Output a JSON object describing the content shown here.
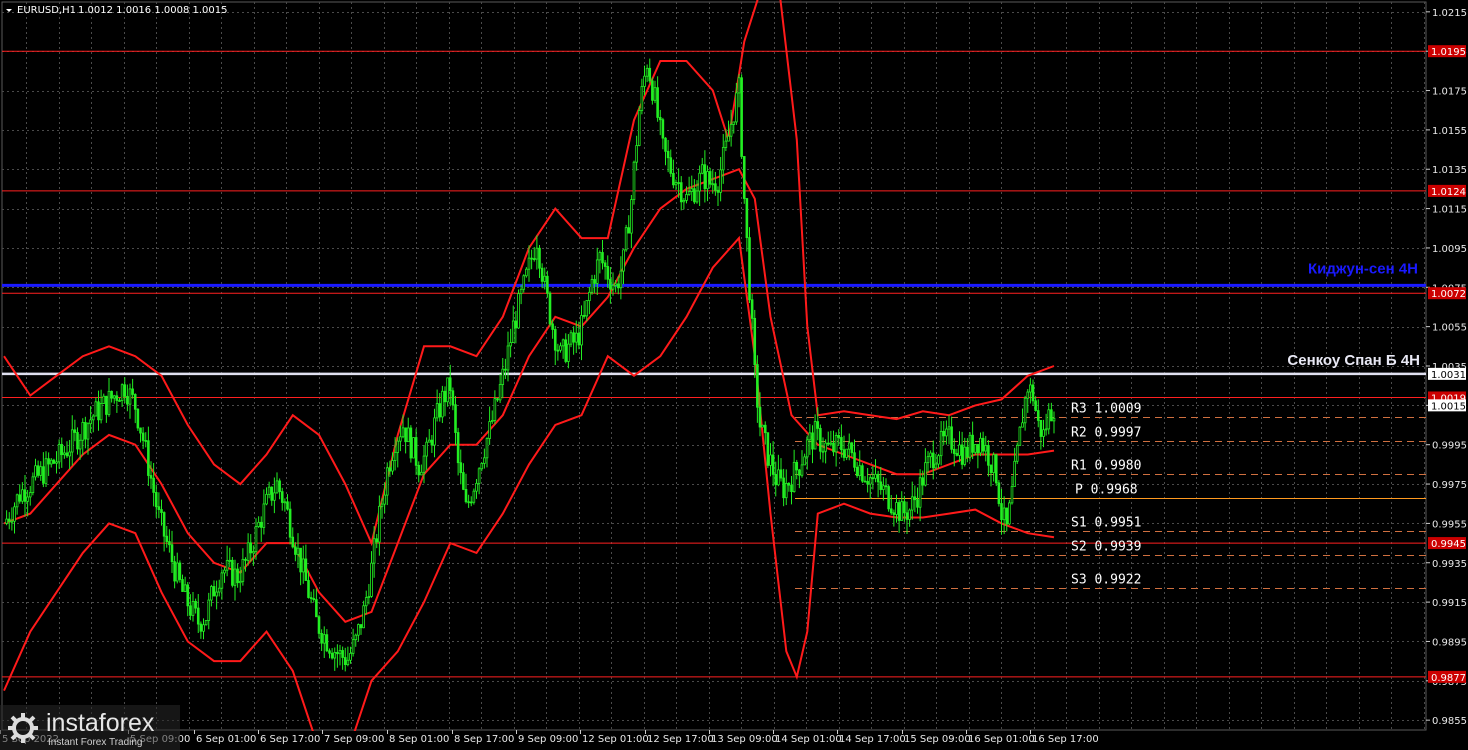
{
  "header": {
    "symbol_label": "EURUSD,H1",
    "ohlc": "1.0012 1.0016 1.0008 1.0015"
  },
  "chart_data": {
    "type": "candlestick",
    "symbol": "EURUSD",
    "timeframe": "H1",
    "ylim": [
      0.985,
      1.022
    ],
    "price_ticks": [
      "1.0215",
      "1.0195",
      "1.0175",
      "1.0155",
      "1.0135",
      "1.0115",
      "1.0095",
      "1.0075",
      "1.0055",
      "1.0035",
      "1.0015",
      "0.9995",
      "0.9975",
      "0.9955",
      "0.9935",
      "0.9915",
      "0.9895",
      "0.9875",
      "0.9855"
    ],
    "time_ticks": [
      "5 Sep 2022",
      "5 Sep 09:00",
      "6 Sep 01:00",
      "6 Sep 17:00",
      "7 Sep 09:00",
      "8 Sep 01:00",
      "8 Sep 17:00",
      "9 Sep 09:00",
      "12 Sep 01:00",
      "12 Sep 17:00",
      "13 Sep 09:00",
      "14 Sep 01:00",
      "14 Sep 17:00",
      "15 Sep 09:00",
      "16 Sep 01:00",
      "16 Sep 17:00"
    ],
    "price_markers": [
      {
        "value": "1.0195",
        "color": "#cc0000"
      },
      {
        "value": "1.0124",
        "color": "#cc0000"
      },
      {
        "value": "1.0072",
        "color": "#cc0000"
      },
      {
        "value": "1.0031",
        "color": "#ffffff"
      },
      {
        "value": "1.0019",
        "color": "#cc0000"
      },
      {
        "value": "1.0015",
        "color": "#ffffff"
      },
      {
        "value": "0.9945",
        "color": "#cc0000"
      },
      {
        "value": "0.9877",
        "color": "#cc0000"
      }
    ],
    "horizontal_levels": [
      {
        "name": "level-10195",
        "value": 1.0195,
        "color": "#ff2020",
        "style": "solid"
      },
      {
        "name": "level-10124",
        "value": 1.0124,
        "color": "#ff2020",
        "style": "solid"
      },
      {
        "name": "kijun-sen-4h",
        "value": 1.0076,
        "color": "#1a1aff",
        "style": "solid"
      },
      {
        "name": "level-10072",
        "value": 1.0072,
        "color": "#ff2020",
        "style": "solid"
      },
      {
        "name": "senkou-span-b-4h",
        "value": 1.0031,
        "color": "#e0e0f0",
        "style": "solid"
      },
      {
        "name": "level-10019",
        "value": 1.0019,
        "color": "#ff2020",
        "style": "solid"
      },
      {
        "name": "level-09945",
        "value": 0.9945,
        "color": "#ff2020",
        "style": "solid"
      },
      {
        "name": "level-09877",
        "value": 0.9877,
        "color": "#ff2020",
        "style": "solid"
      }
    ],
    "pivots": [
      {
        "label": "R3",
        "value": 1.0009
      },
      {
        "label": "R2",
        "value": 0.9997
      },
      {
        "label": "R1",
        "value": 0.998
      },
      {
        "label": "P",
        "value": 0.9968
      },
      {
        "label": "S1",
        "value": 0.9951
      },
      {
        "label": "S2",
        "value": 0.9939
      },
      {
        "label": "S3",
        "value": 0.9922
      }
    ],
    "annotations": {
      "kijun": "Киджун-сен 4Н",
      "senkou": "Сенкоу Спан Б 4Н"
    },
    "close_path": [
      [
        0,
        0.9955
      ],
      [
        3,
        0.9962
      ],
      [
        6,
        0.997
      ],
      [
        10,
        0.9975
      ],
      [
        14,
        0.998
      ],
      [
        18,
        0.9985
      ],
      [
        22,
        0.999
      ],
      [
        26,
        0.9996
      ],
      [
        30,
        1.0003
      ],
      [
        34,
        1.001
      ],
      [
        38,
        1.0015
      ],
      [
        42,
        1.002
      ],
      [
        46,
        1.0025
      ],
      [
        50,
        1.0015
      ],
      [
        53,
        0.9998
      ],
      [
        56,
        0.9978
      ],
      [
        59,
        0.9958
      ],
      [
        62,
        0.9945
      ],
      [
        65,
        0.9932
      ],
      [
        68,
        0.992
      ],
      [
        71,
        0.9912
      ],
      [
        74,
        0.9905
      ],
      [
        77,
        0.9908
      ],
      [
        80,
        0.9922
      ],
      [
        83,
        0.9932
      ],
      [
        86,
        0.993
      ],
      [
        89,
        0.9928
      ],
      [
        92,
        0.9935
      ],
      [
        95,
        0.9946
      ],
      [
        98,
        0.9958
      ],
      [
        101,
        0.9968
      ],
      [
        104,
        0.9975
      ],
      [
        107,
        0.9965
      ],
      [
        110,
        0.995
      ],
      [
        113,
        0.9935
      ],
      [
        116,
        0.992
      ],
      [
        119,
        0.9905
      ],
      [
        122,
        0.9898
      ],
      [
        125,
        0.9892
      ],
      [
        128,
        0.9888
      ],
      [
        131,
        0.9886
      ],
      [
        134,
        0.9895
      ],
      [
        137,
        0.991
      ],
      [
        140,
        0.9932
      ],
      [
        143,
        0.9958
      ],
      [
        146,
        0.9982
      ],
      [
        149,
        0.9998
      ],
      [
        152,
        1.0005
      ],
      [
        155,
        0.9995
      ],
      [
        158,
        0.9985
      ],
      [
        161,
        0.999
      ],
      [
        164,
        1.0005
      ],
      [
        167,
        1.0018
      ],
      [
        170,
        1.0025
      ],
      [
        173,
        0.9985
      ],
      [
        176,
        0.9962
      ],
      [
        179,
        0.9975
      ],
      [
        182,
        0.999
      ],
      [
        185,
        1.0002
      ],
      [
        188,
        1.0018
      ],
      [
        191,
        1.0035
      ],
      [
        194,
        1.0055
      ],
      [
        197,
        1.007
      ],
      [
        200,
        1.0085
      ],
      [
        203,
        1.01
      ],
      [
        206,
        1.0075
      ],
      [
        209,
        1.0055
      ],
      [
        212,
        1.004
      ],
      [
        215,
        1.0045
      ],
      [
        218,
        1.0048
      ],
      [
        221,
        1.0058
      ],
      [
        224,
        1.0078
      ],
      [
        227,
        1.009
      ],
      [
        230,
        1.0082
      ],
      [
        233,
        1.0075
      ],
      [
        236,
        1.0088
      ],
      [
        239,
        1.012
      ],
      [
        242,
        1.0165
      ],
      [
        245,
        1.019
      ],
      [
        248,
        1.017
      ],
      [
        251,
        1.0145
      ],
      [
        254,
        1.0135
      ],
      [
        257,
        1.0128
      ],
      [
        260,
        1.012
      ],
      [
        263,
        1.0125
      ],
      [
        266,
        1.0132
      ],
      [
        269,
        1.0128
      ],
      [
        272,
        1.013
      ],
      [
        275,
        1.0145
      ],
      [
        278,
        1.0165
      ],
      [
        280,
        1.0175
      ],
      [
        282,
        1.012
      ],
      [
        284,
        1.0075
      ],
      [
        286,
        1.003
      ],
      [
        288,
        1.0005
      ],
      [
        291,
        0.999
      ],
      [
        294,
        0.9978
      ],
      [
        297,
        0.9973
      ],
      [
        300,
        0.9978
      ],
      [
        303,
        0.9985
      ],
      [
        306,
        0.9995
      ],
      [
        309,
        1.0
      ],
      [
        312,
        0.9995
      ],
      [
        315,
        0.9992
      ],
      [
        318,
        0.9995
      ],
      [
        321,
        0.9993
      ],
      [
        324,
        0.9988
      ],
      [
        327,
        0.9982
      ],
      [
        330,
        0.9978
      ],
      [
        333,
        0.9974
      ],
      [
        336,
        0.997
      ],
      [
        339,
        0.9965
      ],
      [
        342,
        0.996
      ],
      [
        345,
        0.9962
      ],
      [
        348,
        0.997
      ],
      [
        351,
        0.9982
      ],
      [
        354,
        0.999
      ],
      [
        357,
        0.9995
      ],
      [
        360,
        0.9998
      ],
      [
        363,
        0.9995
      ],
      [
        366,
        0.999
      ],
      [
        369,
        0.9996
      ],
      [
        372,
        0.9998
      ],
      [
        375,
        0.999
      ],
      [
        378,
        0.998
      ],
      [
        380,
        0.996
      ],
      [
        382,
        0.9952
      ],
      [
        384,
        0.997
      ],
      [
        386,
        0.999
      ],
      [
        388,
        1.001
      ],
      [
        390,
        1.0025
      ],
      [
        392,
        1.002
      ],
      [
        394,
        1.0005
      ],
      [
        396,
        1.0
      ],
      [
        398,
        1.001
      ],
      [
        400,
        1.0015
      ]
    ],
    "bollinger": {
      "middle": [
        [
          0,
          0.9955
        ],
        [
          10,
          0.996
        ],
        [
          20,
          0.9975
        ],
        [
          30,
          0.999
        ],
        [
          40,
          1.0
        ],
        [
          50,
          0.9995
        ],
        [
          60,
          0.9975
        ],
        [
          70,
          0.995
        ],
        [
          80,
          0.9935
        ],
        [
          90,
          0.993
        ],
        [
          100,
          0.9945
        ],
        [
          110,
          0.9945
        ],
        [
          120,
          0.992
        ],
        [
          130,
          0.9905
        ],
        [
          140,
          0.991
        ],
        [
          150,
          0.9945
        ],
        [
          160,
          0.998
        ],
        [
          170,
          0.9995
        ],
        [
          180,
          0.9995
        ],
        [
          190,
          1.001
        ],
        [
          200,
          1.004
        ],
        [
          210,
          1.006
        ],
        [
          220,
          1.0055
        ],
        [
          230,
          1.007
        ],
        [
          240,
          1.0095
        ],
        [
          250,
          1.0115
        ],
        [
          260,
          1.0125
        ],
        [
          270,
          1.013
        ],
        [
          280,
          1.0135
        ],
        [
          286,
          1.012
        ],
        [
          292,
          1.006
        ],
        [
          300,
          1.001
        ],
        [
          310,
          0.9995
        ],
        [
          320,
          0.999
        ],
        [
          330,
          0.9985
        ],
        [
          340,
          0.998
        ],
        [
          350,
          0.998
        ],
        [
          360,
          0.9985
        ],
        [
          370,
          0.999
        ],
        [
          380,
          0.999
        ],
        [
          390,
          0.999
        ],
        [
          400,
          0.9992
        ]
      ],
      "upper": [
        [
          0,
          1.004
        ],
        [
          10,
          1.002
        ],
        [
          20,
          1.003
        ],
        [
          30,
          1.004
        ],
        [
          40,
          1.0045
        ],
        [
          50,
          1.004
        ],
        [
          60,
          1.003
        ],
        [
          70,
          1.0005
        ],
        [
          80,
          0.9985
        ],
        [
          90,
          0.9975
        ],
        [
          100,
          0.999
        ],
        [
          110,
          1.001
        ],
        [
          120,
          1.0
        ],
        [
          130,
          0.9975
        ],
        [
          140,
          0.9945
        ],
        [
          150,
          1.0
        ],
        [
          160,
          1.0045
        ],
        [
          170,
          1.0045
        ],
        [
          180,
          1.004
        ],
        [
          190,
          1.006
        ],
        [
          200,
          1.0095
        ],
        [
          210,
          1.0115
        ],
        [
          220,
          1.01
        ],
        [
          230,
          1.01
        ],
        [
          240,
          1.016
        ],
        [
          250,
          1.019
        ],
        [
          260,
          1.019
        ],
        [
          270,
          1.0175
        ],
        [
          276,
          1.015
        ],
        [
          282,
          1.02
        ],
        [
          288,
          1.0225
        ],
        [
          295,
          1.023
        ],
        [
          302,
          1.015
        ],
        [
          306,
          1.0055
        ],
        [
          310,
          1.001
        ],
        [
          320,
          1.0012
        ],
        [
          330,
          1.001
        ],
        [
          340,
          1.0008
        ],
        [
          350,
          1.0012
        ],
        [
          360,
          1.001
        ],
        [
          370,
          1.0015
        ],
        [
          380,
          1.0018
        ],
        [
          390,
          1.003
        ],
        [
          400,
          1.0035
        ]
      ],
      "lower": [
        [
          0,
          0.987
        ],
        [
          10,
          0.99
        ],
        [
          20,
          0.992
        ],
        [
          30,
          0.994
        ],
        [
          40,
          0.9955
        ],
        [
          50,
          0.995
        ],
        [
          60,
          0.992
        ],
        [
          70,
          0.9895
        ],
        [
          80,
          0.9885
        ],
        [
          90,
          0.9885
        ],
        [
          100,
          0.99
        ],
        [
          110,
          0.988
        ],
        [
          120,
          0.984
        ],
        [
          130,
          0.9835
        ],
        [
          140,
          0.9875
        ],
        [
          150,
          0.989
        ],
        [
          160,
          0.9915
        ],
        [
          170,
          0.9945
        ],
        [
          180,
          0.994
        ],
        [
          190,
          0.996
        ],
        [
          200,
          0.9985
        ],
        [
          210,
          1.0005
        ],
        [
          220,
          1.001
        ],
        [
          230,
          1.004
        ],
        [
          240,
          1.003
        ],
        [
          250,
          1.004
        ],
        [
          260,
          1.006
        ],
        [
          270,
          1.0085
        ],
        [
          280,
          1.01
        ],
        [
          286,
          1.004
        ],
        [
          292,
          0.996
        ],
        [
          298,
          0.989
        ],
        [
          302,
          0.9877
        ],
        [
          306,
          0.99
        ],
        [
          310,
          0.996
        ],
        [
          320,
          0.9965
        ],
        [
          330,
          0.996
        ],
        [
          340,
          0.9958
        ],
        [
          350,
          0.9958
        ],
        [
          360,
          0.996
        ],
        [
          370,
          0.9962
        ],
        [
          380,
          0.9955
        ],
        [
          390,
          0.995
        ],
        [
          400,
          0.9948
        ]
      ]
    }
  },
  "watermark": {
    "brand": "instaforex",
    "sub": "Instant Forex Trading"
  }
}
